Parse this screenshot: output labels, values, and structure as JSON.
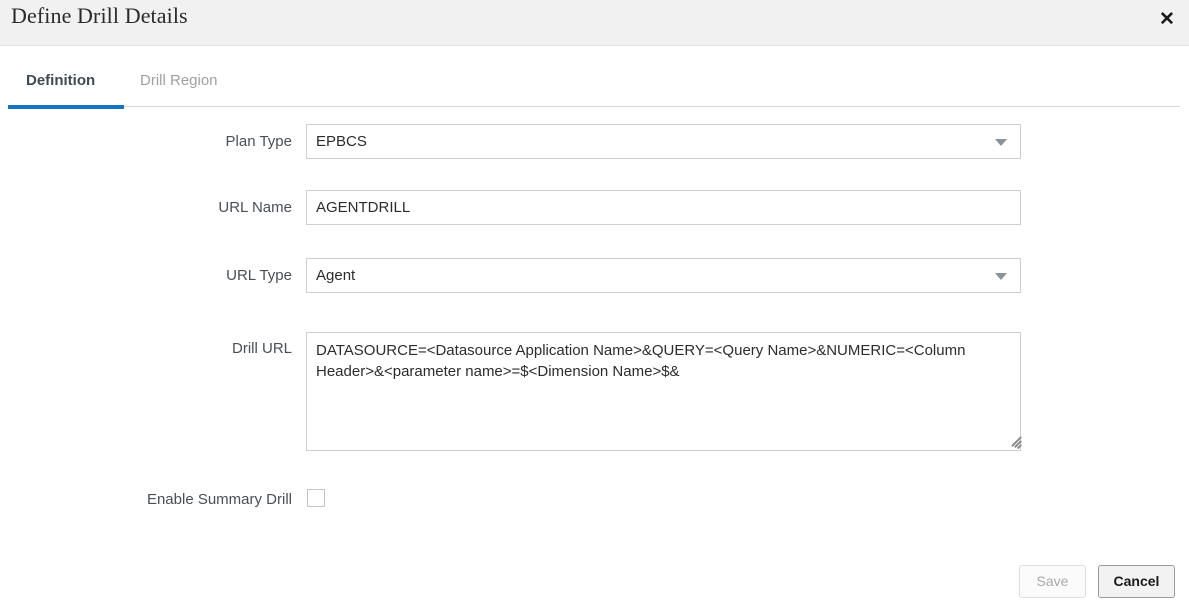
{
  "dialog": {
    "title": "Define Drill Details",
    "close_icon": "close-icon",
    "close_glyph": "✕"
  },
  "tabs": [
    {
      "label": "Definition",
      "selected": true
    },
    {
      "label": "Drill Region",
      "selected": false
    }
  ],
  "form": {
    "fields": [
      {
        "label": "Plan Type",
        "type": "select",
        "value": "EPBCS",
        "icon": "chevron-down-icon"
      },
      {
        "label": "URL Name",
        "type": "text",
        "value": "AGENTDRILL",
        "placeholder": ""
      },
      {
        "label": "URL Type",
        "type": "select",
        "value": "Agent",
        "icon": "chevron-down-icon"
      },
      {
        "label": "Drill URL",
        "type": "textarea",
        "value": "DATASOURCE=<Datasource Application Name>&QUERY=<Query Name>&NUMERIC=<Column Header>&<parameter name>=$<Dimension Name>$&",
        "placeholder": ""
      }
    ],
    "checkbox": {
      "label": "Enable Summary Drill",
      "checked": false
    }
  },
  "footer": {
    "save_label": "Save",
    "save_disabled": true,
    "cancel_label": "Cancel"
  },
  "colors": {
    "accent": "#1175c4",
    "header_band": "#f1f1f1",
    "tab_active_text": "#3f4a54",
    "tab_inactive_text": "#a0a0a0",
    "label_text": "#4a4f55",
    "field_border": "#cfcfcf"
  }
}
